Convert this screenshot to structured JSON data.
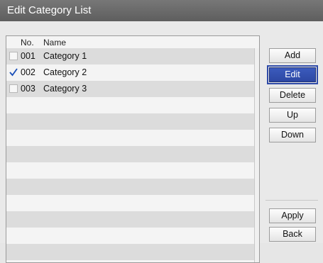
{
  "window": {
    "title": "Edit Category List"
  },
  "list": {
    "columns": {
      "no": "No.",
      "name": "Name"
    },
    "items": [
      {
        "no": "001",
        "name": "Category 1",
        "checked": false
      },
      {
        "no": "002",
        "name": "Category 2",
        "checked": true
      },
      {
        "no": "003",
        "name": "Category 3",
        "checked": false
      }
    ]
  },
  "buttons": {
    "add": "Add",
    "edit": "Edit",
    "delete": "Delete",
    "up": "Up",
    "down": "Down",
    "apply": "Apply",
    "back": "Back"
  },
  "colors": {
    "title_bar": "#666666",
    "selected_button": "#3553b3",
    "check_mark": "#1a4fb8"
  }
}
